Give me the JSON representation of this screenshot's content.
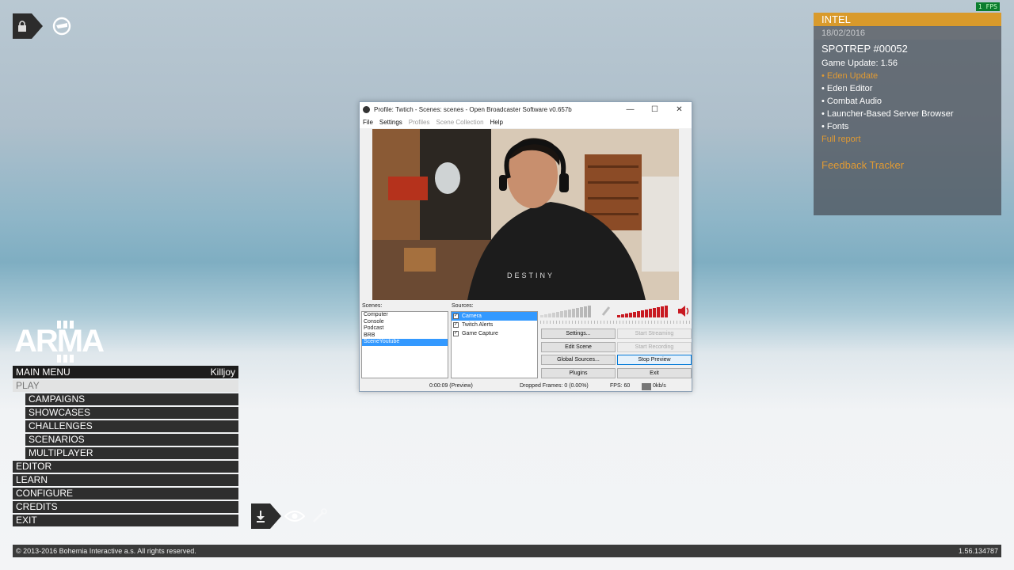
{
  "fps_badge": "1 FPS",
  "intel": {
    "header": "INTEL",
    "date": "18/02/2016",
    "title": "SPOTREP #00052",
    "subtitle": "Game Update: 1.56",
    "items": [
      "• Eden Update",
      "• Eden Editor",
      "• Combat Audio",
      "• Launcher-Based Server Browser",
      "• Fonts"
    ],
    "full_report": "Full report",
    "feedback": "Feedback Tracker"
  },
  "menu": {
    "title": "MAIN MENU",
    "user": "Killjoy",
    "play": "PLAY",
    "play_sub": [
      "CAMPAIGNS",
      "SHOWCASES",
      "CHALLENGES",
      "SCENARIOS",
      "MULTIPLAYER"
    ],
    "items": [
      "EDITOR",
      "LEARN",
      "CONFIGURE",
      "CREDITS",
      "EXIT"
    ]
  },
  "footer": {
    "copyright": "© 2013-2016 Bohemia Interactive a.s. All rights reserved.",
    "version": "1.56.134787"
  },
  "obs": {
    "title": "Profile: Twtich - Scenes: scenes - Open Broadcaster Software v0.657b",
    "menu": [
      "File",
      "Settings",
      "Profiles",
      "Scene Collection",
      "Help"
    ],
    "scenes_label": "Scenes:",
    "sources_label": "Sources:",
    "scenes": [
      "Computer",
      "Console",
      "Podcast",
      "BRB",
      "SceneYoutube"
    ],
    "sources": [
      "Camera",
      "Twitch Alerts",
      "Game Capture"
    ],
    "buttons": {
      "settings": "Settings...",
      "start_streaming": "Start Streaming",
      "edit_scene": "Edit Scene",
      "start_recording": "Start Recording",
      "global_sources": "Global Sources...",
      "stop_preview": "Stop Preview",
      "plugins": "Plugins",
      "exit": "Exit"
    },
    "status": {
      "time": "0:00:09 (Preview)",
      "dropped": "Dropped Frames:  0 (0.00%)",
      "fps": "FPS: 60",
      "bitrate": "0kb/s"
    },
    "colors": {
      "selection": "#3399ff",
      "meter_red": "#cc1122"
    }
  }
}
